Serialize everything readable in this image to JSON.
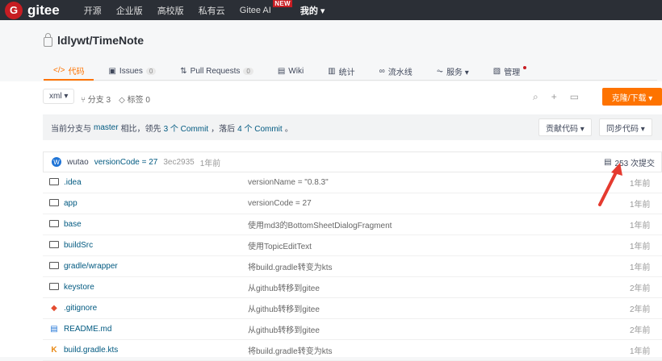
{
  "topbar": {
    "logo": "gitee",
    "logo_letter": "G",
    "nav": [
      "开源",
      "企业版",
      "高校版",
      "私有云",
      "Gitee AI",
      "我的 ▾"
    ],
    "new_badge": "NEW"
  },
  "repo": {
    "title": "ldlywt/TimeNote"
  },
  "tabs": [
    {
      "label": "代码",
      "icon": "</>"
    },
    {
      "label": "Issues",
      "count": "0",
      "icon": "▣"
    },
    {
      "label": "Pull Requests",
      "count": "0",
      "icon": "⇅"
    },
    {
      "label": "Wiki",
      "icon": "▤"
    },
    {
      "label": "统计",
      "icon": "▥"
    },
    {
      "label": "流水线",
      "icon": "∞"
    },
    {
      "label": "服务 ▾",
      "icon": "⏦"
    },
    {
      "label": "管理",
      "icon": "▧"
    }
  ],
  "toolbar": {
    "branch": "xml ▾",
    "branches": "分支 3",
    "tags": "标签 0",
    "clone": "克隆/下载 ▾"
  },
  "notice": {
    "p1": "当前分支与",
    "master": "master",
    "p2": "相比，领先",
    "ahead": "3 个 Commit",
    "p3": "，落后",
    "behind": "4 个 Commit",
    "p4": "。"
  },
  "buttons": {
    "contribute": "贡献代码 ▾",
    "sync": "同步代码 ▾"
  },
  "last_commit": {
    "avatar": "W",
    "author": "wutao",
    "message": "versionCode = 27",
    "hash": "3ec2935",
    "time": "1年前",
    "commits": "253 次提交"
  },
  "files": [
    {
      "name": ".idea",
      "type": "folder",
      "msg": "versionName = \"0.8.3\"",
      "time": "1年前"
    },
    {
      "name": "app",
      "type": "folder",
      "msg": "versionCode = 27",
      "time": "1年前"
    },
    {
      "name": "base",
      "type": "folder",
      "msg": "使用md3的BottomSheetDialogFragment",
      "time": "1年前"
    },
    {
      "name": "buildSrc",
      "type": "folder",
      "msg": "使用TopicEditText",
      "time": "1年前"
    },
    {
      "name": "gradle/wrapper",
      "type": "folder",
      "msg": "将build.gradle转变为kts",
      "time": "1年前"
    },
    {
      "name": "keystore",
      "type": "folder",
      "msg": "从github转移到gitee",
      "time": "2年前"
    },
    {
      "name": ".gitignore",
      "type": "git",
      "msg": "从github转移到gitee",
      "time": "2年前"
    },
    {
      "name": "README.md",
      "type": "md",
      "msg": "从github转移到gitee",
      "time": "2年前"
    },
    {
      "name": "build.gradle.kts",
      "type": "kts",
      "msg": "将build.gradle转变为kts",
      "time": "1年前"
    }
  ]
}
